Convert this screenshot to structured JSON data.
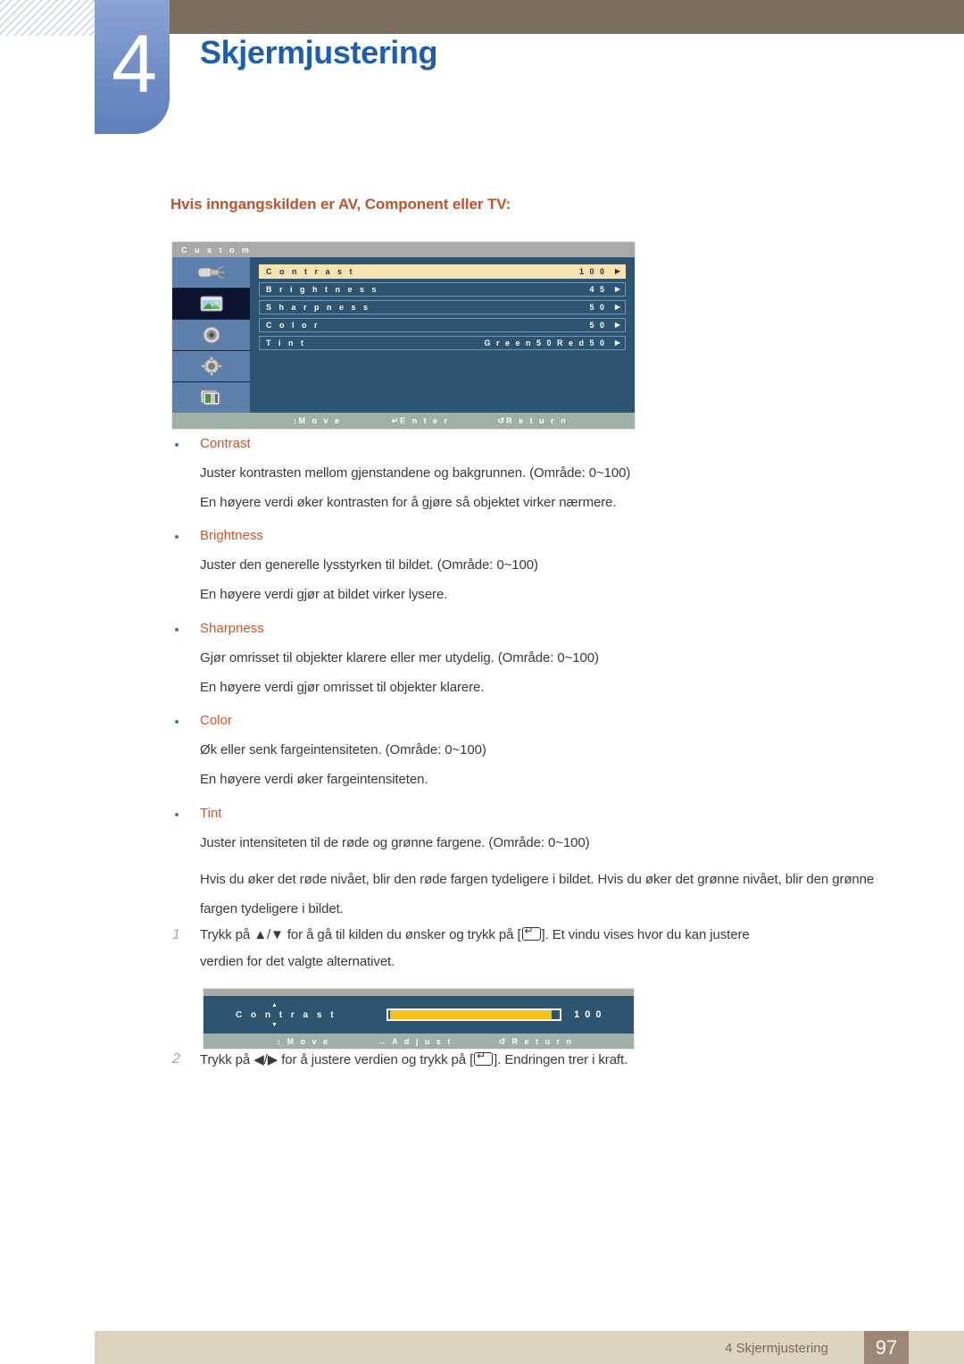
{
  "header": {
    "chapter_number": "4",
    "title": "Skjermjustering",
    "accent_blue": "#1d5fae",
    "chapter_block_color": "#6d8cc4",
    "brown_bar_color": "#7d6f5f"
  },
  "section": {
    "heading": "Hvis inngangskilden er AV, Component eller TV:",
    "heading_color": "#c1522c"
  },
  "osd_menu": {
    "title": "C u s t o m",
    "sidebar_icons": [
      {
        "name": "input-source-icon",
        "selected": false
      },
      {
        "name": "picture-icon",
        "selected": true
      },
      {
        "name": "sound-speaker-icon",
        "selected": false
      },
      {
        "name": "setup-gear-icon",
        "selected": false
      },
      {
        "name": "multi-control-icon",
        "selected": false
      }
    ],
    "rows": [
      {
        "label": "C o n t r a s t",
        "value": "1 0 0",
        "arrow": "▶",
        "active": true
      },
      {
        "label": "B r i g h t n e s s",
        "value": "4 5",
        "arrow": "▶",
        "active": false
      },
      {
        "label": "S h a r p n e s s",
        "value": "5 0",
        "arrow": "▶",
        "active": false
      },
      {
        "label": "C o l o r",
        "value": "5 0",
        "arrow": "▶",
        "active": false
      },
      {
        "label": "T i n t",
        "value": "G r e e n  5 0  R e d  5 0",
        "arrow": "▶",
        "active": false
      }
    ],
    "footer": {
      "move_glyph": "↕",
      "move_label": "M o v e",
      "enter_glyph": "↵",
      "enter_label": "E n t e r",
      "return_glyph": "↺",
      "return_label": "R e t u r n"
    },
    "highlight_color": "#f6e3ad",
    "panel_color": "#2d5572",
    "sidebar_color": "#5c7fab",
    "footer_color": "#9fb0a6"
  },
  "bullets": [
    {
      "term": "Contrast",
      "lines": [
        "Juster kontrasten mellom gjenstandene og bakgrunnen. (Område: 0~100)",
        "En høyere verdi øker kontrasten for å gjøre så objektet virker nærmere."
      ]
    },
    {
      "term": "Brightness",
      "lines": [
        "Juster den generelle lysstyrken til bildet. (Område: 0~100)",
        "En høyere verdi gjør at bildet virker lysere."
      ]
    },
    {
      "term": "Sharpness",
      "lines": [
        "Gjør omrisset til objekter klarere eller mer utydelig. (Område: 0~100)",
        "En høyere verdi gjør omrisset til objekter klarere."
      ]
    },
    {
      "term": "Color",
      "lines": [
        "Øk eller senk fargeintensiteten. (Område: 0~100)",
        "En høyere verdi øker fargeintensiteten."
      ]
    },
    {
      "term": "Tint",
      "lines": [
        "Juster intensiteten til de røde og grønne fargene. (Område: 0~100)",
        "Hvis du øker det røde nivået, blir den røde fargen tydeligere i bildet. Hvis du øker det grønne nivået, blir den grønne fargen tydeligere i bildet."
      ]
    }
  ],
  "steps": [
    {
      "number": "1",
      "text_before": "Trykk på ▲/▼ for å gå til kilden du ønsker og trykk på [",
      "text_after": "]. Et vindu vises hvor du kan justere",
      "text_wrap": "verdien for det valgte alternativet."
    },
    {
      "number": "2",
      "text_before": "Trykk på ◀/▶ for å justere verdien og trykk på [",
      "text_after": "]. Endringen trer i kraft."
    }
  ],
  "osd_slider": {
    "label": "C o n t r a s t",
    "value": "1 0 0",
    "fill_percent": 96,
    "fill_color": "#f5c21a",
    "spin_up": "▲",
    "spin_down": "▼",
    "footer": {
      "move_glyph": "↕",
      "move_label": "M o v e",
      "adjust_glyph": "↔",
      "adjust_label": "A d j u s t",
      "return_glyph": "↺",
      "return_label": "R e t u r n"
    }
  },
  "footer": {
    "text": "4 Skjermjustering",
    "page_number": "97",
    "band_color": "#ded2c1",
    "page_box_color": "#9d8878"
  }
}
